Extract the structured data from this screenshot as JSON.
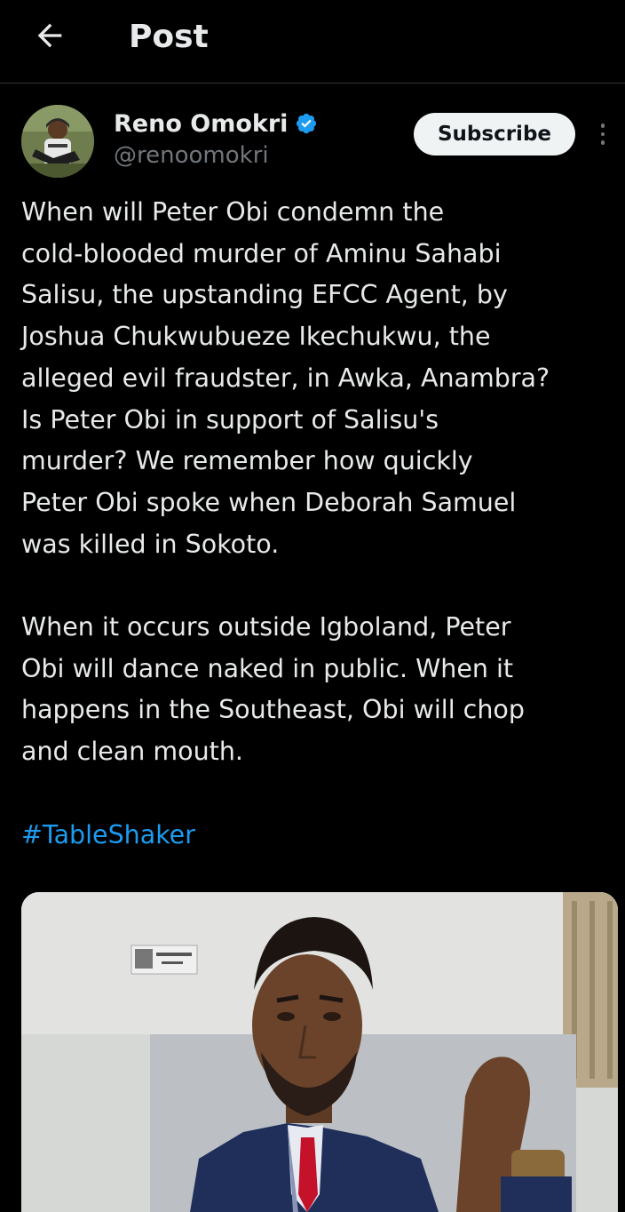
{
  "header": {
    "title": "Post",
    "back_icon": "arrow-left-icon"
  },
  "author": {
    "name": "Reno Omokri",
    "handle": "@renoomokri",
    "verified": true,
    "verified_color": "#1d9bf0"
  },
  "actions": {
    "subscribe_label": "Subscribe",
    "more_icon": "more-vertical-icon"
  },
  "tweet": {
    "paragraph_1_lines": [
      "When will Peter Obi condemn the",
      "cold-blooded murder of Aminu Sahabi",
      "Salisu, the upstanding EFCC Agent, by",
      "Joshua Chukwubueze Ikechukwu, the",
      "alleged evil fraudster, in Awka, Anambra?",
      "Is Peter Obi in support of Salisu's",
      "murder? We remember how quickly",
      "Peter Obi spoke when Deborah Samuel",
      "was killed in Sokoto."
    ],
    "paragraph_2_lines": [
      "When it occurs outside Igboland, Peter",
      "Obi will dance naked in public. When it",
      "happens in the Southeast, Obi will chop",
      "and clean mouth."
    ],
    "hashtag": "#TableShaker",
    "hashtag_color": "#1d9bf0"
  },
  "media": {
    "type": "photo"
  },
  "colors": {
    "background": "#000000",
    "text": "#e7e9ea",
    "secondary_text": "#71767b",
    "divider": "#2f3336"
  }
}
